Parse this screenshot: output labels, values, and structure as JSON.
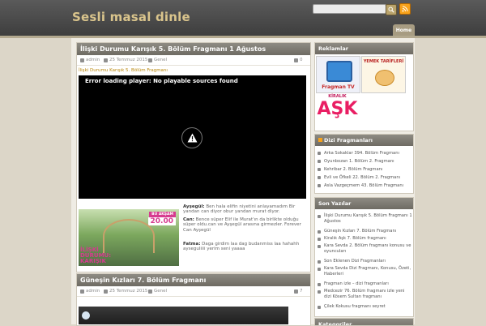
{
  "header": {
    "site_title": "Sesli masal dinle",
    "search": {
      "placeholder": ""
    },
    "nav": {
      "home": "Home"
    }
  },
  "posts": [
    {
      "title": "İlişki Durumu Karışık 5. Bölüm Fragmanı 1 Ağustos",
      "author": "admin",
      "date": "25 Temmuz 2015",
      "category": "Genel",
      "comments": "0",
      "link_text": "İlişki Durumu Karışık 5. Bölüm Fragmanı",
      "video_error": "Error loading player: No playable sources found",
      "thumb": {
        "badge_top": "BU AKŞAM",
        "badge_time": "20.00",
        "logo_line1": "İLİŞKİ",
        "logo_line2": "DURUMU:",
        "logo_line3": "KARIŞIK"
      },
      "dialogue": [
        {
          "speaker": "Ayşegül:",
          "text": "Ben hala elifin niyetini anlayamadım Bir yandan can diyor obur yandan murat diyor."
        },
        {
          "speaker": "Can:",
          "text": "Bence süper Elif ile Murat'ın da birlikte olduğu süper oldu.can ve Ayşegül arasına girmezler. Forever Can Ayşegül"
        },
        {
          "speaker": "Fatma:",
          "text": "Daga girdim laa dag budanmiss laa hahahh ayseguliiii yerim seni yaaaa"
        }
      ]
    },
    {
      "title": "Güneşin Kızları 7. Bölüm Fragmanı",
      "author": "admin",
      "date": "25 Temmuz 2015",
      "category": "Genel",
      "comments": "7"
    }
  ],
  "sidebar": {
    "reklamlar": {
      "title": "Reklamlar",
      "ad1": "Fragman TV",
      "ad2": "YEMEK TARİFLERİ",
      "ad3_top": "KİRALIK",
      "ad3_main": "AŞK"
    },
    "dizi": {
      "title": "Dizi Fragmanları",
      "items": [
        "Arka Sokaklar 394. Bölüm Fragmanı",
        "Oyunbozan 1. Bölüm 2. Fragmanı",
        "Kehribar 2. Bölüm Fragmanı",
        "Evli ve Öfkeli 22. Bölüm 2. Fragmanı",
        "Asla Vazgeçmem 43. Bölüm Fragmanı"
      ]
    },
    "son": {
      "title": "Son Yazılar",
      "items": [
        "İlişki Durumu Karışık 5. Bölüm Fragmanı 1 Ağustos",
        "Güneşin Kızları 7. Bölüm Fragmanı",
        "Kiralık Aşk 7. Bölüm fragmanı",
        "Kara Sevda 2. Bölüm fragmanı konusu ve oyuncuları",
        "Son Eklenen Dizi Fragmanları",
        "Kara Sevda Dizi Fragmanı, Konusu, Özeti, Haberleri",
        "Fragman izle – dizi fragmanları",
        "Medcezir 76. Bölüm fragmanı izle yeni dizi Kösem Sultan fragmanı",
        "Çilek Kokusu fragmanı seyret"
      ]
    },
    "kategoriler": {
      "title": "Kategoriler"
    }
  }
}
